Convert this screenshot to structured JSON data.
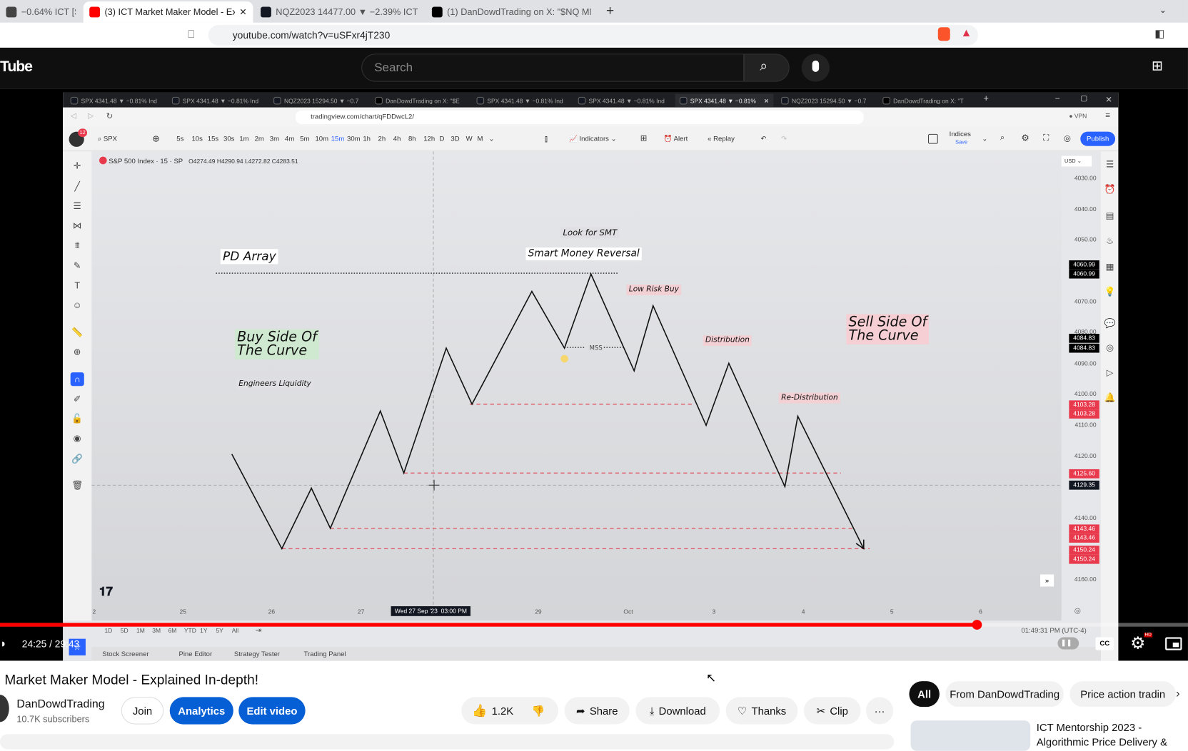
{
  "browser": {
    "tabs": [
      {
        "label": "−0.64% ICT [S][∞][S]",
        "icon": "tradingview-icon",
        "color": "#444444"
      },
      {
        "label": "(3) ICT Market Maker Model - Ex",
        "icon": "youtube-icon",
        "color": "#ff0000",
        "active": true
      },
      {
        "label": "NQZ2023 14477.00 ▼ −2.39% ICT [S][",
        "icon": "tradingview-icon",
        "color": "#131722"
      },
      {
        "label": "(1) DanDowdTrading on X: \"$NQ MMS",
        "icon": "x-icon",
        "color": "#000000"
      }
    ],
    "url": "youtube.com/watch?v=uSFxr4jT230"
  },
  "youtube": {
    "logo": "Tube",
    "search_placeholder": "Search"
  },
  "tradingview": {
    "tabs": [
      "SPX 4341.48 ▼ −0.81% Ind",
      "SPX 4341.48 ▼ −0.81% Ind",
      "NQZ2023 15294.50 ▼ −0.7",
      "DanDowdTrading on X: \"$E",
      "SPX 4341.48 ▼ −0.81% Ind",
      "SPX 4341.48 ▼ −0.81% Ind",
      "SPX 4341.48 ▼ −0.81%",
      "NQZ2023 15294.50 ▼ −0.7",
      "DanDowdTrading on X: \"T"
    ],
    "active_tab": 6,
    "url": "tradingview.com/chart/qFDDwcL2/",
    "vpn": "VPN",
    "badge": "12",
    "symbol": "SPX",
    "intervals": [
      "5s",
      "10s",
      "15s",
      "30s",
      "1m",
      "2m",
      "3m",
      "4m",
      "5m",
      "10m",
      "15m",
      "30m",
      "1h",
      "2h",
      "4h",
      "8h",
      "12h",
      "D",
      "3D",
      "W",
      "M"
    ],
    "active_interval": "15m",
    "indicators": "Indicators",
    "alert": "Alert",
    "replay": "Replay",
    "layout_name": "Indices",
    "layout_save": "Save",
    "publish": "Publish",
    "currency": "USD",
    "legend": {
      "title": "S&P 500 Index · 15 · SP",
      "ohlc": "O4274.49 H4290.94 L4272.82 C4283.51"
    },
    "price_labels": [
      "4030.00",
      "4040.00",
      "4050.00",
      "4070.00",
      "4080.00",
      "4090.00",
      "4100.00",
      "4110.00",
      "4120.00",
      "4140.00",
      "4160.00"
    ],
    "price_badges": [
      {
        "text": "4060.99",
        "color": "#000000"
      },
      {
        "text": "4060.99",
        "color": "#000000"
      },
      {
        "text": "4084.83",
        "color": "#000000"
      },
      {
        "text": "4084.83",
        "color": "#000000"
      },
      {
        "text": "4103.28",
        "color": "#e8394d"
      },
      {
        "text": "4103.28",
        "color": "#e8394d"
      },
      {
        "text": "4125.60",
        "color": "#e8394d"
      },
      {
        "text": "4129.35",
        "color": "#131722"
      },
      {
        "text": "4143.46",
        "color": "#e8394d"
      },
      {
        "text": "4143.46",
        "color": "#e8394d"
      },
      {
        "text": "4150.24",
        "color": "#e8394d"
      },
      {
        "text": "4150.24",
        "color": "#e8394d"
      }
    ],
    "time_labels": [
      "2",
      "25",
      "26",
      "27",
      "29",
      "Oct",
      "3",
      "4",
      "5",
      "6"
    ],
    "crosshair_time": "Wed 27 Sep '23  03:00 PM",
    "annotations": {
      "pd_array": "PD Array",
      "look_smt": "Look for SMT",
      "smr": "Smart Money Reversal",
      "low_risk_buy": "Low Risk Buy",
      "buy_side": "Buy Side Of\nThe Curve",
      "engineers": "Engineers Liquidity",
      "mss": "MSS",
      "distribution": "Distribution",
      "sell_side": "Sell Side Of\nThe Curve",
      "redistribution": "Re-Distribution"
    },
    "ranges": [
      "1D",
      "5D",
      "1M",
      "3M",
      "6M",
      "YTD",
      "1Y",
      "5Y",
      "All"
    ],
    "clock": "01:49:31 PM (UTC-4)",
    "bottom_tabs": [
      "Stock Screener",
      "Pine Editor",
      "Strategy Tester",
      "Trading Panel"
    ]
  },
  "player": {
    "time": "24:25 / 29:43",
    "progress_percent": 82.2,
    "hd": "HD",
    "cc": "CC"
  },
  "video": {
    "title": "Market Maker Model - Explained In-depth!",
    "channel": "DanDowdTrading",
    "subscribers": "10.7K subscribers",
    "join": "Join",
    "analytics": "Analytics",
    "edit": "Edit video",
    "likes": "1.2K",
    "share": "Share",
    "download": "Download",
    "thanks": "Thanks",
    "clip": "Clip",
    "more": "···"
  },
  "sidebar": {
    "chips": [
      "All",
      "From DanDowdTrading",
      "Price action tradin"
    ],
    "rec_title": "ICT Mentorship 2023 -\nAlgorithmic Price Delivery &"
  }
}
